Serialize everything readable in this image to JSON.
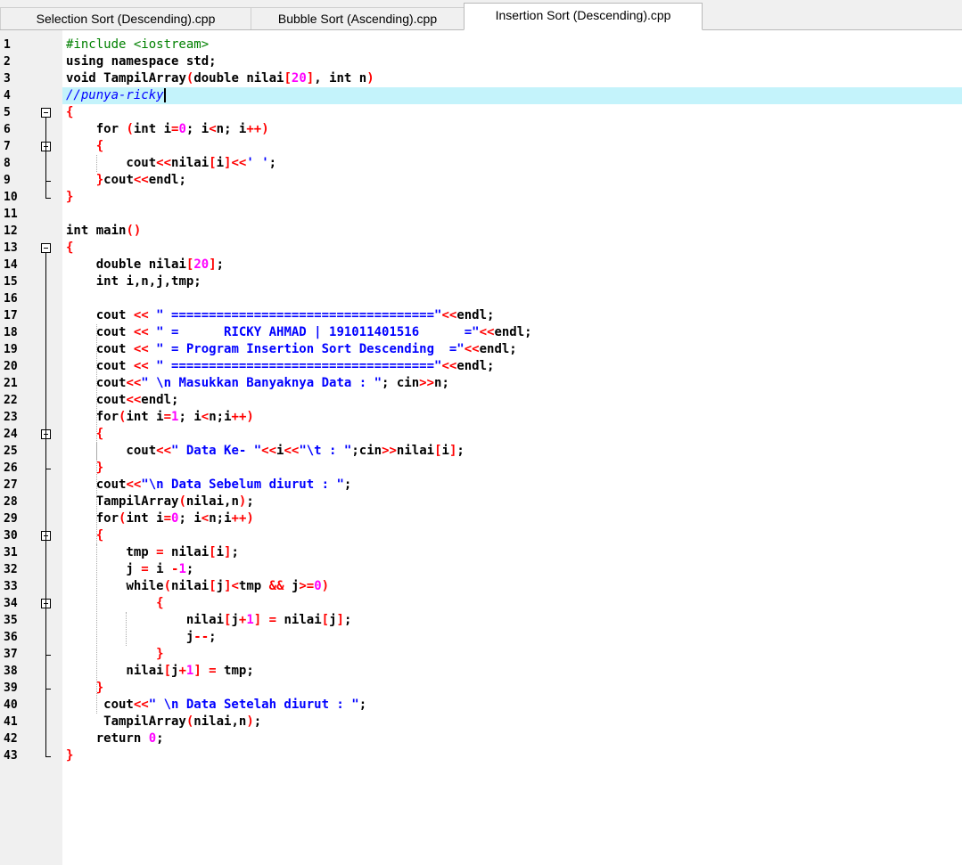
{
  "tabs": [
    {
      "label": "Selection Sort (Descending).cpp",
      "active": false
    },
    {
      "label": "Bubble Sort (Ascending).cpp",
      "active": false
    },
    {
      "label": "Insertion Sort (Descending).cpp",
      "active": true
    }
  ],
  "editor": {
    "highlighted_line": 4,
    "lines": [
      [
        [
          "pp",
          "#include <iostream>"
        ]
      ],
      [
        [
          "kw",
          "using namespace "
        ],
        [
          "plain",
          "std;"
        ]
      ],
      [
        [
          "kw",
          "void "
        ],
        [
          "plain",
          "TampilArray"
        ],
        [
          "op",
          "("
        ],
        [
          "kw",
          "double "
        ],
        [
          "plain",
          "nilai"
        ],
        [
          "op",
          "["
        ],
        [
          "num",
          "20"
        ],
        [
          "op",
          "]"
        ],
        [
          "plain",
          ", "
        ],
        [
          "kw",
          "int "
        ],
        [
          "plain",
          "n"
        ],
        [
          "op",
          ")"
        ]
      ],
      [
        [
          "cm",
          "//punya-ricky"
        ]
      ],
      [
        [
          "op",
          "{"
        ]
      ],
      [
        [
          "plain",
          "    "
        ],
        [
          "kw",
          "for "
        ],
        [
          "op",
          "("
        ],
        [
          "kw",
          "int "
        ],
        [
          "plain",
          "i"
        ],
        [
          "op",
          "="
        ],
        [
          "num",
          "0"
        ],
        [
          "plain",
          "; i"
        ],
        [
          "op",
          "<"
        ],
        [
          "plain",
          "n; i"
        ],
        [
          "op",
          "++)"
        ]
      ],
      [
        [
          "plain",
          "    "
        ],
        [
          "op",
          "{"
        ]
      ],
      [
        [
          "plain",
          "        cout"
        ],
        [
          "op",
          "<<"
        ],
        [
          "plain",
          "nilai"
        ],
        [
          "op",
          "["
        ],
        [
          "plain",
          "i"
        ],
        [
          "op",
          "]<<"
        ],
        [
          "str",
          "' '"
        ],
        [
          "plain",
          ";"
        ]
      ],
      [
        [
          "plain",
          "    "
        ],
        [
          "op",
          "}"
        ],
        [
          "plain",
          "cout"
        ],
        [
          "op",
          "<<"
        ],
        [
          "plain",
          "endl;"
        ]
      ],
      [
        [
          "op",
          "}"
        ]
      ],
      [
        [
          "plain",
          ""
        ]
      ],
      [
        [
          "kw",
          "int "
        ],
        [
          "plain",
          "main"
        ],
        [
          "op",
          "()"
        ]
      ],
      [
        [
          "op",
          "{"
        ]
      ],
      [
        [
          "plain",
          "    "
        ],
        [
          "kw",
          "double "
        ],
        [
          "plain",
          "nilai"
        ],
        [
          "op",
          "["
        ],
        [
          "num",
          "20"
        ],
        [
          "op",
          "]"
        ],
        [
          "plain",
          ";"
        ]
      ],
      [
        [
          "plain",
          "    "
        ],
        [
          "kw",
          "int "
        ],
        [
          "plain",
          "i,n,j,tmp;"
        ]
      ],
      [
        [
          "plain",
          ""
        ]
      ],
      [
        [
          "plain",
          "    cout "
        ],
        [
          "op",
          "<< "
        ],
        [
          "str",
          "\" ===================================\""
        ],
        [
          "op",
          "<<"
        ],
        [
          "plain",
          "endl;"
        ]
      ],
      [
        [
          "plain",
          "    cout "
        ],
        [
          "op",
          "<< "
        ],
        [
          "str",
          "\" =      RICKY AHMAD | 191011401516      =\""
        ],
        [
          "op",
          "<<"
        ],
        [
          "plain",
          "endl;"
        ]
      ],
      [
        [
          "plain",
          "    cout "
        ],
        [
          "op",
          "<< "
        ],
        [
          "str",
          "\" = Program Insertion Sort Descending  =\""
        ],
        [
          "op",
          "<<"
        ],
        [
          "plain",
          "endl;"
        ]
      ],
      [
        [
          "plain",
          "    cout "
        ],
        [
          "op",
          "<< "
        ],
        [
          "str",
          "\" ===================================\""
        ],
        [
          "op",
          "<<"
        ],
        [
          "plain",
          "endl;"
        ]
      ],
      [
        [
          "plain",
          "    cout"
        ],
        [
          "op",
          "<<"
        ],
        [
          "str",
          "\" \\n Masukkan Banyaknya Data : \""
        ],
        [
          "plain",
          "; cin"
        ],
        [
          "op",
          ">>"
        ],
        [
          "plain",
          "n;"
        ]
      ],
      [
        [
          "plain",
          "    cout"
        ],
        [
          "op",
          "<<"
        ],
        [
          "plain",
          "endl;"
        ]
      ],
      [
        [
          "plain",
          "    "
        ],
        [
          "kw",
          "for"
        ],
        [
          "op",
          "("
        ],
        [
          "kw",
          "int "
        ],
        [
          "plain",
          "i"
        ],
        [
          "op",
          "="
        ],
        [
          "num",
          "1"
        ],
        [
          "plain",
          "; i"
        ],
        [
          "op",
          "<"
        ],
        [
          "plain",
          "n;i"
        ],
        [
          "op",
          "++)"
        ]
      ],
      [
        [
          "plain",
          "    "
        ],
        [
          "op",
          "{"
        ]
      ],
      [
        [
          "plain",
          "        cout"
        ],
        [
          "op",
          "<<"
        ],
        [
          "str",
          "\" Data Ke- \""
        ],
        [
          "op",
          "<<"
        ],
        [
          "plain",
          "i"
        ],
        [
          "op",
          "<<"
        ],
        [
          "str",
          "\"\\t : \""
        ],
        [
          "plain",
          ";cin"
        ],
        [
          "op",
          ">>"
        ],
        [
          "plain",
          "nilai"
        ],
        [
          "op",
          "["
        ],
        [
          "plain",
          "i"
        ],
        [
          "op",
          "]"
        ],
        [
          "plain",
          ";"
        ]
      ],
      [
        [
          "plain",
          "    "
        ],
        [
          "op",
          "}"
        ]
      ],
      [
        [
          "plain",
          "    cout"
        ],
        [
          "op",
          "<<"
        ],
        [
          "str",
          "\"\\n Data Sebelum diurut : \""
        ],
        [
          "plain",
          ";"
        ]
      ],
      [
        [
          "plain",
          "    TampilArray"
        ],
        [
          "op",
          "("
        ],
        [
          "plain",
          "nilai,n"
        ],
        [
          "op",
          ")"
        ],
        [
          "plain",
          ";"
        ]
      ],
      [
        [
          "plain",
          "    "
        ],
        [
          "kw",
          "for"
        ],
        [
          "op",
          "("
        ],
        [
          "kw",
          "int "
        ],
        [
          "plain",
          "i"
        ],
        [
          "op",
          "="
        ],
        [
          "num",
          "0"
        ],
        [
          "plain",
          "; i"
        ],
        [
          "op",
          "<"
        ],
        [
          "plain",
          "n;i"
        ],
        [
          "op",
          "++)"
        ]
      ],
      [
        [
          "plain",
          "    "
        ],
        [
          "op",
          "{"
        ]
      ],
      [
        [
          "plain",
          "        tmp "
        ],
        [
          "op",
          "= "
        ],
        [
          "plain",
          "nilai"
        ],
        [
          "op",
          "["
        ],
        [
          "plain",
          "i"
        ],
        [
          "op",
          "]"
        ],
        [
          "plain",
          ";"
        ]
      ],
      [
        [
          "plain",
          "        j "
        ],
        [
          "op",
          "= "
        ],
        [
          "plain",
          "i "
        ],
        [
          "op",
          "-"
        ],
        [
          "num",
          "1"
        ],
        [
          "plain",
          ";"
        ]
      ],
      [
        [
          "plain",
          "        "
        ],
        [
          "kw",
          "while"
        ],
        [
          "op",
          "("
        ],
        [
          "plain",
          "nilai"
        ],
        [
          "op",
          "["
        ],
        [
          "plain",
          "j"
        ],
        [
          "op",
          "]<"
        ],
        [
          "plain",
          "tmp "
        ],
        [
          "op",
          "&& "
        ],
        [
          "plain",
          "j"
        ],
        [
          "op",
          ">="
        ],
        [
          "num",
          "0"
        ],
        [
          "op",
          ")"
        ]
      ],
      [
        [
          "plain",
          "            "
        ],
        [
          "op",
          "{"
        ]
      ],
      [
        [
          "plain",
          "                nilai"
        ],
        [
          "op",
          "["
        ],
        [
          "plain",
          "j"
        ],
        [
          "op",
          "+"
        ],
        [
          "num",
          "1"
        ],
        [
          "op",
          "] = "
        ],
        [
          "plain",
          "nilai"
        ],
        [
          "op",
          "["
        ],
        [
          "plain",
          "j"
        ],
        [
          "op",
          "]"
        ],
        [
          "plain",
          ";"
        ]
      ],
      [
        [
          "plain",
          "                j"
        ],
        [
          "op",
          "--"
        ],
        [
          "plain",
          ";"
        ]
      ],
      [
        [
          "plain",
          "            "
        ],
        [
          "op",
          "}"
        ]
      ],
      [
        [
          "plain",
          "        nilai"
        ],
        [
          "op",
          "["
        ],
        [
          "plain",
          "j"
        ],
        [
          "op",
          "+"
        ],
        [
          "num",
          "1"
        ],
        [
          "op",
          "] = "
        ],
        [
          "plain",
          "tmp;"
        ]
      ],
      [
        [
          "plain",
          "    "
        ],
        [
          "op",
          "}"
        ]
      ],
      [
        [
          "plain",
          "     cout"
        ],
        [
          "op",
          "<<"
        ],
        [
          "str",
          "\" \\n Data Setelah diurut : \""
        ],
        [
          "plain",
          ";"
        ]
      ],
      [
        [
          "plain",
          "     TampilArray"
        ],
        [
          "op",
          "("
        ],
        [
          "plain",
          "nilai,n"
        ],
        [
          "op",
          ")"
        ],
        [
          "plain",
          ";"
        ]
      ],
      [
        [
          "plain",
          "    "
        ],
        [
          "kw",
          "return "
        ],
        [
          "num",
          "0"
        ],
        [
          "plain",
          ";"
        ]
      ],
      [
        [
          "op",
          "}"
        ]
      ]
    ]
  },
  "colors": {
    "keyword": "#000000",
    "string": "#0000ff",
    "number": "#ff00ff",
    "operator": "#ff0000",
    "comment": "#0000ff",
    "preprocessor": "#008000",
    "current_line_bg": "#c4f3fb",
    "gutter_bg": "#f0f0f0"
  }
}
